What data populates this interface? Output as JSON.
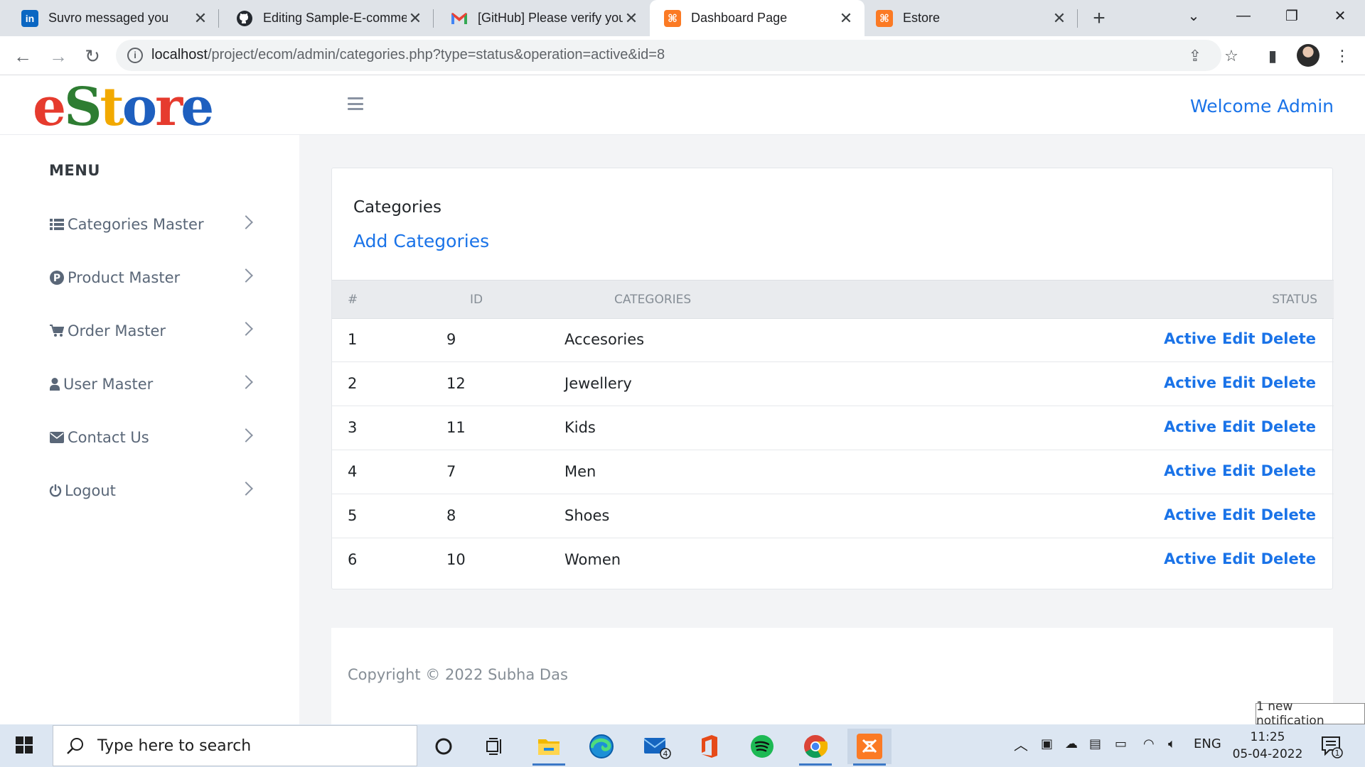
{
  "browser": {
    "tabs": [
      {
        "label": "Suvro messaged you",
        "icon": "linkedin-icon",
        "color": "#0a66c2"
      },
      {
        "label": "Editing Sample-E-commerce",
        "icon": "github-icon",
        "color": "#24292f"
      },
      {
        "label": "[GitHub] Please verify your",
        "icon": "gmail-icon",
        "color": "#ea4335"
      },
      {
        "label": "Dashboard Page",
        "icon": "xampp-icon",
        "color": "#fb7a24"
      },
      {
        "label": "Estore",
        "icon": "xampp-icon",
        "color": "#fb7a24"
      }
    ],
    "active_tab": "Dashboard Page",
    "url_host": "localhost",
    "url_path": "/project/ecom/admin/categories.php?type=status&operation=active&id=8"
  },
  "header": {
    "logo_text": "eStore",
    "logo_colors": [
      "#e63b2e",
      "#2e7d32",
      "#f2a900",
      "#1e5fbf",
      "#e63b2e",
      "#1e5fbf"
    ],
    "welcome": "Welcome Admin"
  },
  "sidebar": {
    "title": "MENU",
    "items": [
      {
        "label": "Categories Master",
        "icon": "list-icon"
      },
      {
        "label": "Product Master",
        "icon": "product-p-icon"
      },
      {
        "label": "Order Master",
        "icon": "cart-icon"
      },
      {
        "label": "User Master",
        "icon": "user-icon"
      },
      {
        "label": "Contact Us",
        "icon": "envelope-icon"
      },
      {
        "label": "Logout",
        "icon": "power-icon"
      }
    ]
  },
  "main": {
    "card_title": "Categories",
    "add_link": "Add Categories",
    "columns": [
      "#",
      "ID",
      "Categories",
      "Status"
    ],
    "rows": [
      {
        "num": "1",
        "id": "9",
        "name": "Accesories"
      },
      {
        "num": "2",
        "id": "12",
        "name": "Jewellery"
      },
      {
        "num": "3",
        "id": "11",
        "name": "Kids"
      },
      {
        "num": "4",
        "id": "7",
        "name": "Men"
      },
      {
        "num": "5",
        "id": "8",
        "name": "Shoes"
      },
      {
        "num": "6",
        "id": "10",
        "name": "Women"
      }
    ],
    "actions": {
      "active": "Active",
      "edit": "Edit",
      "delete": "Delete"
    },
    "accent_color": "#1a73e8"
  },
  "footer": {
    "copyright": "Copyright © 2022 Subha Das"
  },
  "notification": "1 new notification",
  "taskbar": {
    "search_placeholder": "Type here to search",
    "mail_badge": "4",
    "language": "ENG",
    "time": "11:25",
    "date": "05-04-2022",
    "action_center_badge": "1"
  }
}
